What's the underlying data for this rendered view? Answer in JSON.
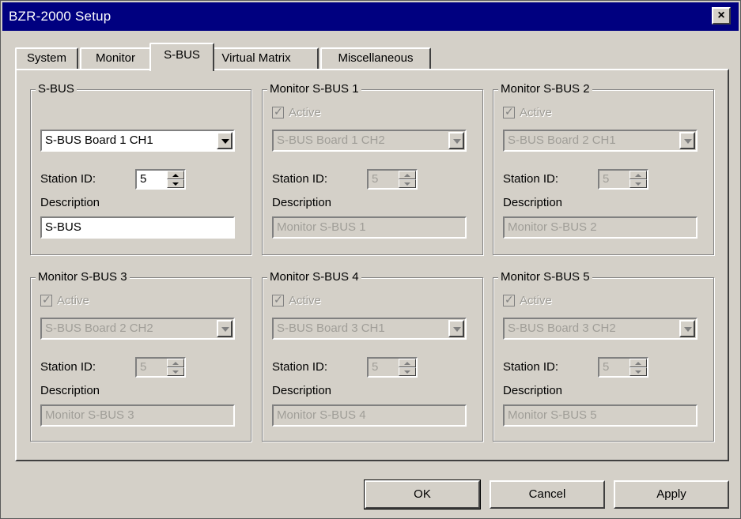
{
  "window": {
    "title": "BZR-2000 Setup",
    "close_label": "×"
  },
  "tabs": [
    {
      "label": "System",
      "active": false
    },
    {
      "label": "Monitor",
      "active": false
    },
    {
      "label": "S-BUS",
      "active": true
    },
    {
      "label": "Virtual Matrix",
      "active": false
    },
    {
      "label": "Miscellaneous",
      "active": false
    }
  ],
  "groups": [
    {
      "title": "S-BUS",
      "has_active": false,
      "combo": "S-BUS Board 1 CH1",
      "station_id_label": "Station ID:",
      "station_id": "5",
      "description_label": "Description",
      "description": "S-BUS",
      "enabled": true
    },
    {
      "title": "Monitor S-BUS 1",
      "has_active": true,
      "active_label": "Active",
      "combo": "S-BUS Board 1 CH2",
      "station_id_label": "Station ID:",
      "station_id": "5",
      "description_label": "Description",
      "description": "Monitor S-BUS 1",
      "enabled": false
    },
    {
      "title": "Monitor S-BUS 2",
      "has_active": true,
      "active_label": "Active",
      "combo": "S-BUS Board 2 CH1",
      "station_id_label": "Station ID:",
      "station_id": "5",
      "description_label": "Description",
      "description": "Monitor S-BUS 2",
      "enabled": false
    },
    {
      "title": "Monitor S-BUS 3",
      "has_active": true,
      "active_label": "Active",
      "combo": "S-BUS Board 2 CH2",
      "station_id_label": "Station ID:",
      "station_id": "5",
      "description_label": "Description",
      "description": "Monitor S-BUS 3",
      "enabled": false
    },
    {
      "title": "Monitor S-BUS 4",
      "has_active": true,
      "active_label": "Active",
      "combo": "S-BUS Board 3 CH1",
      "station_id_label": "Station ID:",
      "station_id": "5",
      "description_label": "Description",
      "description": "Monitor S-BUS 4",
      "enabled": false
    },
    {
      "title": "Monitor S-BUS 5",
      "has_active": true,
      "active_label": "Active",
      "combo": "S-BUS Board 3 CH2",
      "station_id_label": "Station ID:",
      "station_id": "5",
      "description_label": "Description",
      "description": "Monitor S-BUS 5",
      "enabled": false
    }
  ],
  "buttons": {
    "ok": "OK",
    "cancel": "Cancel",
    "apply": "Apply"
  },
  "colors": {
    "titlebar": "#000080",
    "face": "#d4d0c8",
    "disabled_text": "#a09e98"
  }
}
